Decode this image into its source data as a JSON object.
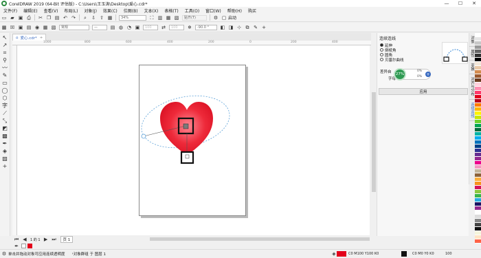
{
  "window": {
    "title": "CorelDRAW 2019 (64-Bit 评估版) - C:\\Users\\王玉涛\\Desktop\\爱心.cdr*",
    "minimize_glyph": "—",
    "maximize_glyph": "☐",
    "close_glyph": "✕"
  },
  "menu": [
    "文件(F)",
    "编辑(E)",
    "查看(V)",
    "布局(L)",
    "对象(J)",
    "效果(C)",
    "位图(B)",
    "文本(X)",
    "表格(T)",
    "工具(O)",
    "窗口(W)",
    "帮助(H)",
    "购买"
  ],
  "toolbar1": {
    "zoom": "34%",
    "snap": "贴齐(T)",
    "launch": "启动"
  },
  "toolbar2": {
    "style": "常规",
    "stroke": "—",
    "angle": "-90.0 °",
    "fields": [
      "100",
      "100",
      "0",
      "1"
    ]
  },
  "document": {
    "tab_label": "爱心.cdr*"
  },
  "ruler": {
    "h_ticks": [
      "1000",
      "800",
      "600",
      "400",
      "200",
      "0",
      "200",
      "400",
      "600"
    ],
    "v_ticks": [
      "300",
      "200",
      "100",
      "0",
      "100",
      "200",
      "300",
      "400"
    ]
  },
  "docker": {
    "title": "连续连线",
    "options": [
      {
        "label": "延伸",
        "selected": true
      },
      {
        "label": "倒棱角",
        "selected": false
      },
      {
        "label": "圆角",
        "selected": false
      },
      {
        "label": "贝塞尔曲线",
        "selected": false
      }
    ],
    "section_label": "差异自",
    "second_label": "字母",
    "percent": "27%",
    "small_values": [
      "0%",
      "0%"
    ],
    "apply_label": "应用"
  },
  "side_tabs": [
    "对象",
    "属性",
    "变换",
    "对齐与分布",
    "连续连线"
  ],
  "palette": [
    "#ffffff",
    "#e6e6e6",
    "#c8c8c8",
    "#999999",
    "#666666",
    "#333333",
    "#000000",
    "#f2e6d9",
    "#e9c9a8",
    "#d48c4f",
    "#9b5a2e",
    "#6b3b1e",
    "#ffd1dc",
    "#ff8fb1",
    "#ff3b6b",
    "#e3001b",
    "#b8001a",
    "#ff7a00",
    "#ffb400",
    "#fff200",
    "#c8e600",
    "#6ccf2e",
    "#00a651",
    "#006b3c",
    "#00b3a4",
    "#00aeef",
    "#0072bc",
    "#003f87",
    "#2e3192",
    "#662d91",
    "#92278f",
    "#ec008c",
    "#f49ac1",
    "#c2b59b",
    "#8c6239",
    "#fbb03b",
    "#f7931e",
    "#d4145a",
    "#8cc63f",
    "#39b54a",
    "#29abe2",
    "#1b1464",
    "#93278f",
    "#ffffff",
    "#dddddd",
    "#888888",
    "#444444",
    "#111111",
    "#f5f5dc",
    "#ffe4c4",
    "#ff6347"
  ],
  "status": {
    "left": "单击并拖动对象可应用连续透明度",
    "object_info": "对象群组 于 图层 1",
    "fill_info": "C0 M100 Y100 K0",
    "outline_info": "C0 M0 Y0 K0",
    "outline_width": "100",
    "page_tab": "页 1"
  },
  "colors": {
    "heart_fill": "#e3001b",
    "accent_blue": "#3a6bc1",
    "slider_green": "#2e9a52"
  }
}
